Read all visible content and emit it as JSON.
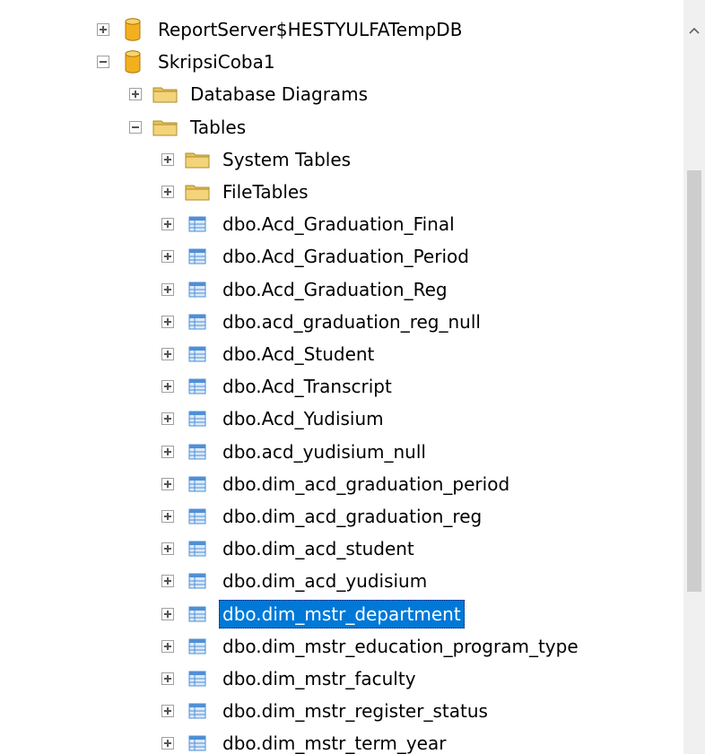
{
  "object_explorer": {
    "nodes": [
      {
        "label": "ReportServer$HESTYULFATempDB",
        "icon": "database-icon",
        "expander": "plus",
        "level": 0
      },
      {
        "label": "SkripsiCoba1",
        "icon": "database-icon",
        "expander": "minus",
        "level": 0
      },
      {
        "label": "Database Diagrams",
        "icon": "folder-icon",
        "expander": "plus",
        "level": 1
      },
      {
        "label": "Tables",
        "icon": "folder-icon",
        "expander": "minus",
        "level": 1
      },
      {
        "label": "System Tables",
        "icon": "folder-icon",
        "expander": "plus",
        "level": 2
      },
      {
        "label": "FileTables",
        "icon": "folder-icon",
        "expander": "plus",
        "level": 2
      },
      {
        "label": "dbo.Acd_Graduation_Final",
        "icon": "table-icon",
        "expander": "plus",
        "level": 2
      },
      {
        "label": "dbo.Acd_Graduation_Period",
        "icon": "table-icon",
        "expander": "plus",
        "level": 2
      },
      {
        "label": "dbo.Acd_Graduation_Reg",
        "icon": "table-icon",
        "expander": "plus",
        "level": 2
      },
      {
        "label": "dbo.acd_graduation_reg_null",
        "icon": "table-icon",
        "expander": "plus",
        "level": 2
      },
      {
        "label": "dbo.Acd_Student",
        "icon": "table-icon",
        "expander": "plus",
        "level": 2
      },
      {
        "label": "dbo.Acd_Transcript",
        "icon": "table-icon",
        "expander": "plus",
        "level": 2
      },
      {
        "label": "dbo.Acd_Yudisium",
        "icon": "table-icon",
        "expander": "plus",
        "level": 2
      },
      {
        "label": "dbo.acd_yudisium_null",
        "icon": "table-icon",
        "expander": "plus",
        "level": 2
      },
      {
        "label": "dbo.dim_acd_graduation_period",
        "icon": "table-icon",
        "expander": "plus",
        "level": 2
      },
      {
        "label": "dbo.dim_acd_graduation_reg",
        "icon": "table-icon",
        "expander": "plus",
        "level": 2
      },
      {
        "label": "dbo.dim_acd_student",
        "icon": "table-icon",
        "expander": "plus",
        "level": 2
      },
      {
        "label": "dbo.dim_acd_yudisium",
        "icon": "table-icon",
        "expander": "plus",
        "level": 2
      },
      {
        "label": "dbo.dim_mstr_department",
        "icon": "table-icon",
        "expander": "plus",
        "level": 2,
        "selected": true
      },
      {
        "label": "dbo.dim_mstr_education_program_type",
        "icon": "table-icon",
        "expander": "plus",
        "level": 2
      },
      {
        "label": "dbo.dim_mstr_faculty",
        "icon": "table-icon",
        "expander": "plus",
        "level": 2
      },
      {
        "label": "dbo.dim_mstr_register_status",
        "icon": "table-icon",
        "expander": "plus",
        "level": 2
      },
      {
        "label": "dbo.dim_mstr_term_year",
        "icon": "table-icon",
        "expander": "plus",
        "level": 2
      }
    ]
  },
  "colors": {
    "selection": "#0078d7",
    "folder": "#e8c25c",
    "database": "#f2b01e",
    "table": "#4f8fd6"
  }
}
